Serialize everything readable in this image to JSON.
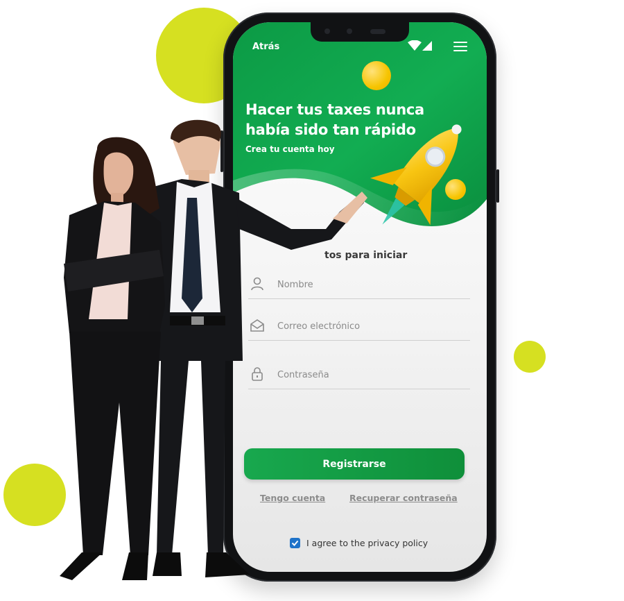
{
  "colors": {
    "brand_green": "#12a04a",
    "accent_yellow": "#d6e021",
    "rocket_yellow": "#f6c400",
    "checkbox_blue": "#1f73c9"
  },
  "header": {
    "back_label": "Atrás",
    "signal_icon": "wifi-signal-icon",
    "menu_icon": "hamburger-menu-icon"
  },
  "hero": {
    "title": "Hacer tus taxes nunca había sido tan rápido",
    "subtitle": "Crea tu cuenta hoy",
    "illustration_icon": "rocket-icon"
  },
  "form": {
    "heading": "tos para iniciar",
    "fields": [
      {
        "placeholder": "Nombre",
        "value": "",
        "icon": "user-icon"
      },
      {
        "placeholder": "Correo electrónico",
        "value": "",
        "icon": "envelope-icon"
      },
      {
        "placeholder": "Contraseña",
        "value": "",
        "icon": "lock-icon"
      }
    ],
    "submit_label": "Registrarse",
    "have_account_link": "Tengo cuenta",
    "recover_password_link": "Recuperar contraseña",
    "privacy_label": "I agree to the privacy policy",
    "privacy_checked": true
  }
}
